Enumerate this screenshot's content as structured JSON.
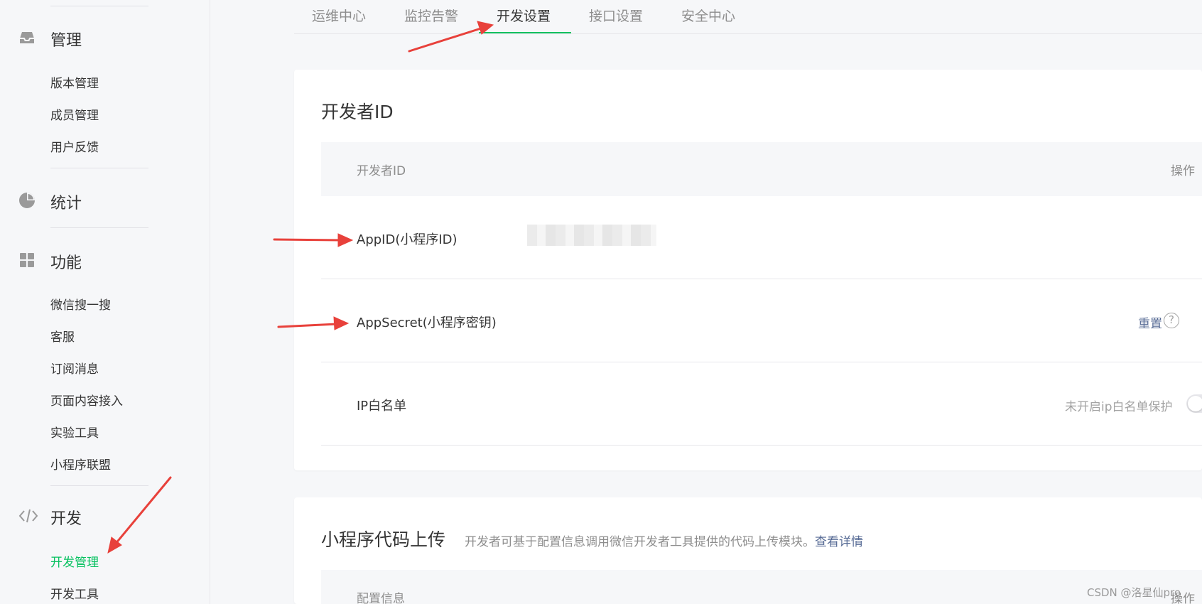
{
  "sidebar": {
    "groups": [
      {
        "label": "管理",
        "icon": "inbox-icon",
        "items": [
          "版本管理",
          "成员管理",
          "用户反馈"
        ]
      },
      {
        "label": "统计",
        "icon": "pie-chart-icon",
        "items": []
      },
      {
        "label": "功能",
        "icon": "grid-icon",
        "items": [
          "微信搜一搜",
          "客服",
          "订阅消息",
          "页面内容接入",
          "实验工具",
          "小程序联盟"
        ]
      },
      {
        "label": "开发",
        "icon": "code-icon",
        "items": [
          "开发管理",
          "开发工具"
        ]
      }
    ],
    "active_item": "开发管理"
  },
  "tabs": [
    "运维中心",
    "监控告警",
    "开发设置",
    "接口设置",
    "安全中心"
  ],
  "active_tab": "开发设置",
  "developer_id_card": {
    "title": "开发者ID",
    "header": {
      "col1": "开发者ID",
      "col2": "操作"
    },
    "rows": [
      {
        "label": "AppID(小程序ID)"
      },
      {
        "label": "AppSecret(小程序密钥)",
        "action": "重置",
        "help": "?"
      },
      {
        "label": "IP白名单",
        "status": "未开启ip白名单保护",
        "toggle_on": false
      }
    ]
  },
  "upload_card": {
    "title": "小程序代码上传",
    "description": "开发者可基于配置信息调用微信开发者工具提供的代码上传模块。",
    "link": "查看详情",
    "header": {
      "col1": "配置信息",
      "col2": "操作"
    }
  },
  "watermark": "CSDN @洛星仙pro",
  "colors": {
    "accent": "#07c160",
    "link": "#576b95",
    "annotation_arrow": "#e8413b"
  }
}
